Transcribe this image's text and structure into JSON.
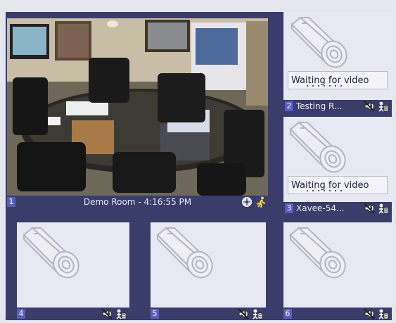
{
  "cameras": [
    {
      "number": "1",
      "name": "Demo Room - 4:16:55 PM",
      "status": "live",
      "icons": [
        "ptz-icon",
        "motion-icon"
      ]
    },
    {
      "number": "2",
      "name": "Testing R...",
      "status": "Waiting for video",
      "icons": [
        "no-audio-icon",
        "recording-off-icon"
      ]
    },
    {
      "number": "3",
      "name": "Xavee-54...",
      "status": "Waiting for video",
      "icons": [
        "no-audio-icon",
        "recording-off-icon"
      ]
    },
    {
      "number": "4",
      "name": "",
      "status": "",
      "icons": [
        "no-audio-icon",
        "recording-off-icon"
      ]
    },
    {
      "number": "5",
      "name": "",
      "status": "",
      "icons": [
        "no-audio-icon",
        "recording-off-icon"
      ]
    },
    {
      "number": "6",
      "name": "",
      "status": "",
      "icons": [
        "no-audio-icon",
        "recording-off-icon"
      ]
    }
  ],
  "colors": {
    "frame": "#3a3c6a",
    "placeholder": "#e8e8f2",
    "number_badge": "#5a5cc0"
  }
}
